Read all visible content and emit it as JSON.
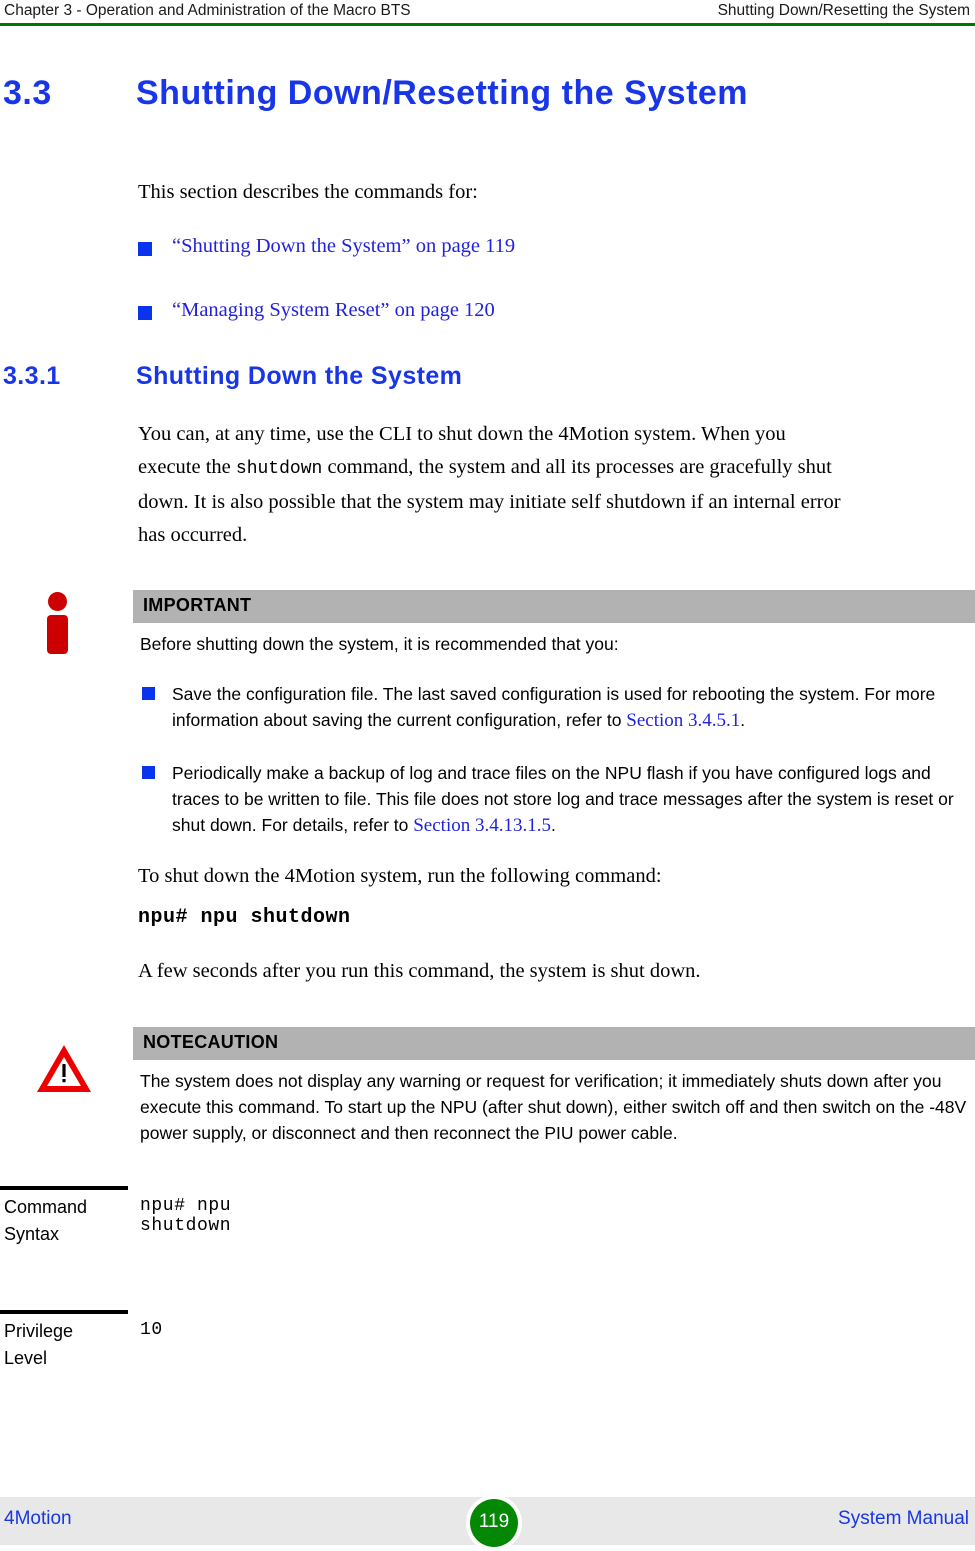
{
  "header": {
    "left": "Chapter 3 - Operation and Administration of the Macro BTS",
    "right": "Shutting Down/Resetting the System",
    "rule_color": "#007800"
  },
  "section": {
    "number": "3.3",
    "title": "Shutting Down/Resetting the System",
    "heading_color": "#1836e8"
  },
  "intro": {
    "text": "This section describes the commands for:"
  },
  "xrefs": [
    {
      "label": "“Shutting Down the System” on page 119"
    },
    {
      "label": "“Managing System Reset” on page 120"
    }
  ],
  "subsection": {
    "number": "3.3.1",
    "title": "Shutting Down the System",
    "paragraph_1": "You can, at any time, use the CLI to shut down the 4Motion system. When you execute the ",
    "paragraph_1_code": "shutdown",
    "paragraph_1_cont": " command, the system and all its processes are gracefully shut down. It is also possible that the system may initiate self shutdown if an internal error has occurred."
  },
  "important_box": {
    "icon": "red-info-icon",
    "title": "IMPORTANT",
    "lead": "Before shutting down the system, it is recommended that you:",
    "bullets": [
      {
        "text": "Save the configuration file. The last saved configuration is used for rebooting the system. For more information about saving the current configuration, refer to ",
        "link": "Section 3.4.5.1",
        "tail": "."
      },
      {
        "text": "Periodically make a backup of log and trace files on the NPU flash if you have configured logs and traces to be written to file. This file does not store log and trace messages after the system is reset or shut down. For details, refer to ",
        "link": "Section 3.4.13.1.5",
        "tail": "."
      }
    ],
    "bar_color": "#b2b2b2"
  },
  "run_command": {
    "lead": "To shut down the 4Motion system, run the following command:",
    "command": "npu# npu shutdown",
    "after": "A few seconds after you run this command, the system is shut down."
  },
  "caution_box": {
    "icon": "red-warning-triangle-icon",
    "title": "NOTECAUTION",
    "text": "The system does not display any warning or request for verification; it immediately shuts down after you execute this command. To start up the NPU (after shut down), either switch off and then switch on the -48V power supply, or disconnect and then reconnect the PIU power cable.",
    "bar_color": "#b2b2b2"
  },
  "command_table": {
    "rows": [
      {
        "label": "Command Syntax",
        "label_line1": "Command",
        "label_line2": "Syntax",
        "value": "npu# npu shutdown"
      },
      {
        "label": "Privilege Level",
        "label_line1": "Privilege",
        "label_line2": "Level",
        "value": "10"
      }
    ]
  },
  "footer": {
    "left": "4Motion",
    "page": "119",
    "right": "System Manual",
    "badge_color": "#048804",
    "band_color": "#e8e8e8",
    "text_color": "#1836e8"
  }
}
